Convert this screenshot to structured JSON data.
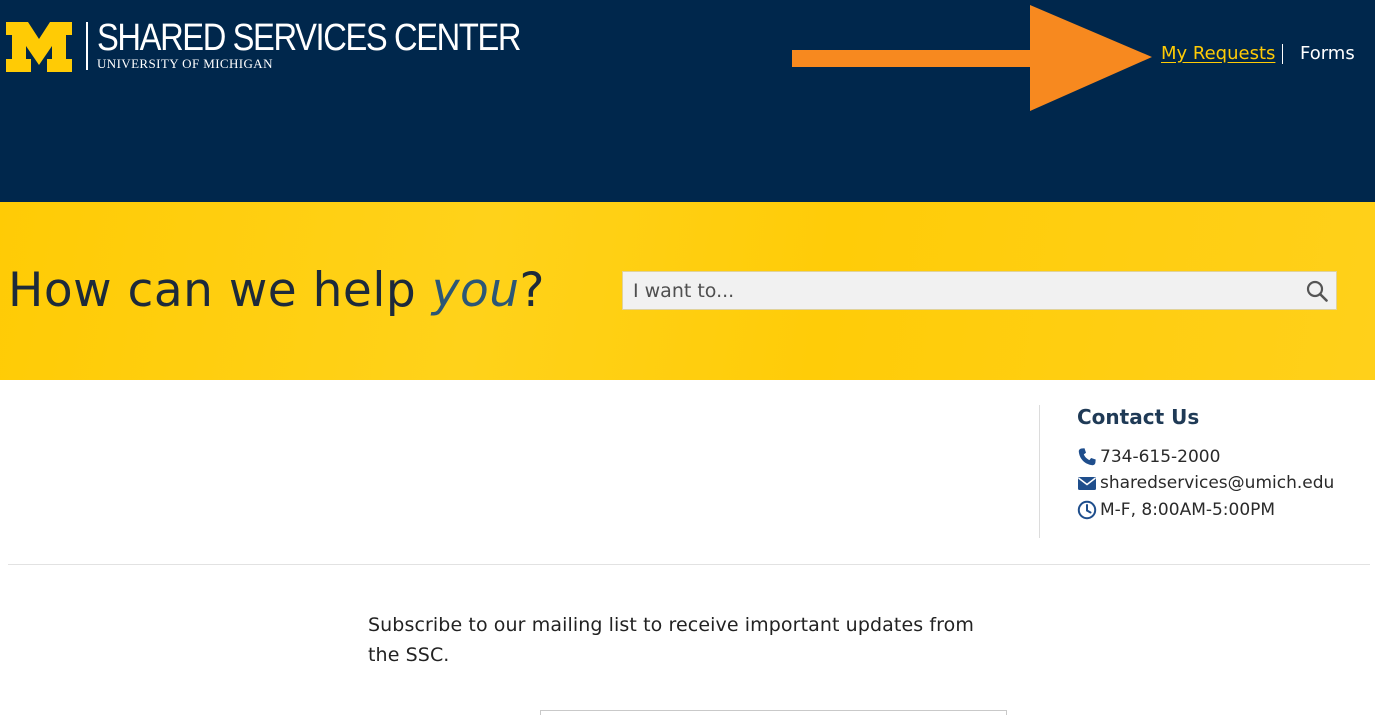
{
  "colors": {
    "header_bg": "#00274c",
    "brand_maize": "#ffcb05",
    "arrow": "#f7891f",
    "contact_icons": "#1f4e8c"
  },
  "header": {
    "logo_letter": "M",
    "title": "SHARED SERVICES CENTER",
    "subtitle": "UNIVERSITY OF MICHIGAN",
    "nav": {
      "my_requests": "My Requests",
      "forms": "Forms"
    }
  },
  "hero": {
    "title_prefix": "How can we help ",
    "title_em": "you",
    "title_suffix": "?",
    "search_placeholder": "I want to...",
    "search_icon": "search-icon"
  },
  "contact": {
    "title": "Contact Us",
    "phone": "734-615-2000",
    "email": "sharedservices@umich.edu",
    "hours": "M-F, 8:00AM-5:00PM",
    "icons": [
      "phone-icon",
      "envelope-icon",
      "clock-icon"
    ]
  },
  "subscribe": {
    "text": "Subscribe to our mailing list to receive important updates from the SSC."
  }
}
